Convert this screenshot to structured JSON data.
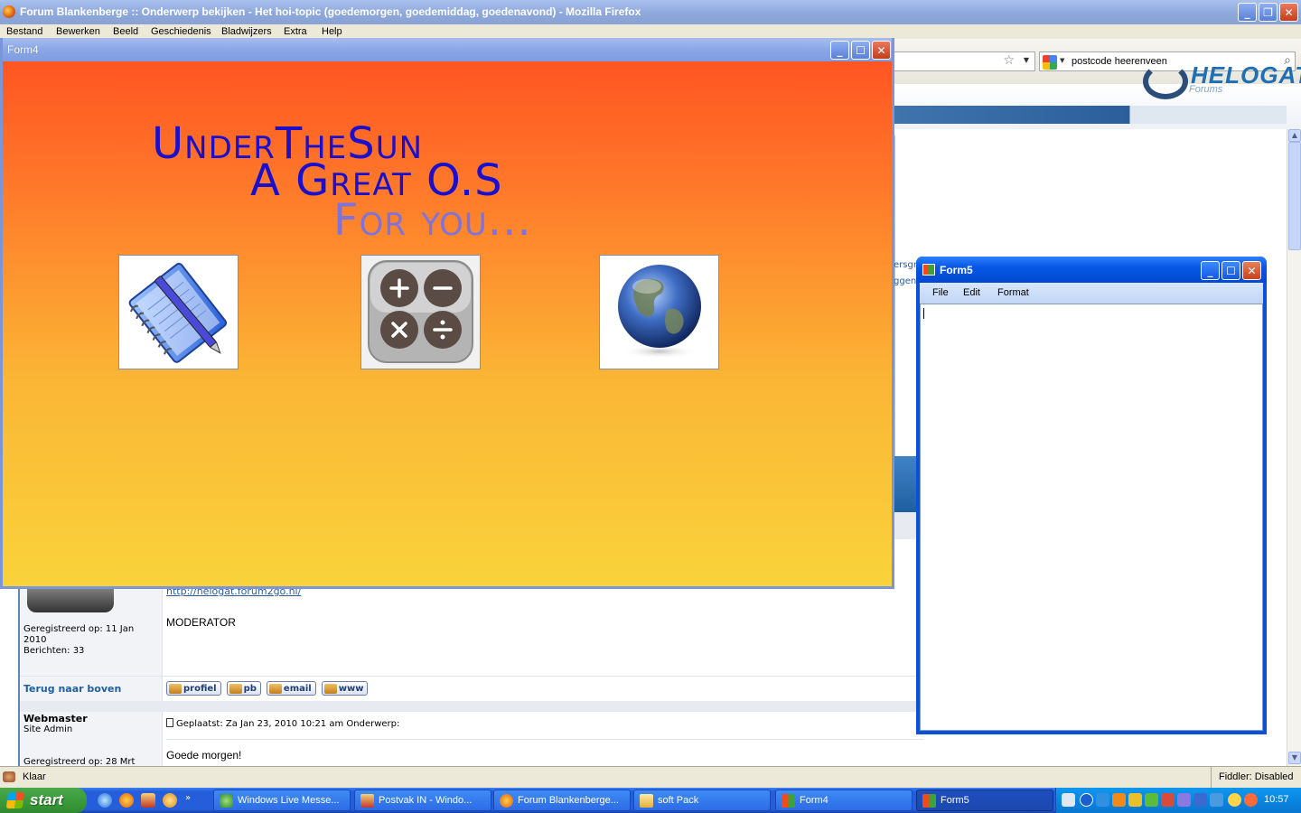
{
  "firefox": {
    "title": "Forum Blankenberge :: Onderwerp bekijken - Het hoi-topic (goedemorgen, goedemiddag, goedenavond) - Mozilla Firefox",
    "menu": [
      "Bestand",
      "Bewerken",
      "Beeld",
      "Geschiedenis",
      "Bladwijzers",
      "Extra",
      "Help"
    ],
    "search_value": "postcode heerenveen",
    "status": "Klaar",
    "fiddler": "Fiddler: Disabled"
  },
  "site": {
    "logo_text": "HELOGAT",
    "logo_sub": "Forums",
    "partial_link_1": "ersgr",
    "partial_link_2": "ggen"
  },
  "forum": {
    "post1_url": "http://helogat.forum2go.nl/",
    "post1_role": "MODERATOR",
    "post1_registered": "Geregistreerd op: 11 Jan 2010",
    "post1_posts": "Berichten: 33",
    "back_to_top": "Terug naar boven",
    "buttons": [
      "profiel",
      "pb",
      "email",
      "www"
    ],
    "post2_user": "Webmaster",
    "post2_role": "Site Admin",
    "post2_posted": "Geplaatst: Za Jan 23, 2010 10:21 am    Onderwerp:",
    "post2_message": "Goede morgen!",
    "post2_registered": "Geregistreerd op: 28 Mrt"
  },
  "form4": {
    "title": "Form4",
    "logo_line1": "UnderTheSun",
    "logo_line2": "A Great O.S",
    "logo_line3": "For you...",
    "apps": [
      {
        "name": "notepad",
        "icon": "notepad-icon"
      },
      {
        "name": "calculator",
        "icon": "calculator-icon"
      },
      {
        "name": "browser",
        "icon": "globe-icon"
      }
    ],
    "colors": {
      "top": "#ff5522",
      "bottom": "#f9d33b",
      "logo": "#1a0fcc",
      "logo_light": "#7c72e0"
    }
  },
  "form5": {
    "title": "Form5",
    "menu": [
      "File",
      "Edit",
      "Format"
    ],
    "text_value": ""
  },
  "taskbar": {
    "start": "start",
    "tasks": [
      {
        "label": "Windows Live Messe...",
        "active": false
      },
      {
        "label": "Postvak IN - Windo...",
        "active": false
      },
      {
        "label": "Forum Blankenberge...",
        "active": false
      },
      {
        "label": "soft Pack",
        "active": false
      },
      {
        "label": "Form4",
        "active": false
      },
      {
        "label": "Form5",
        "active": true
      }
    ],
    "clock": "10:57"
  }
}
